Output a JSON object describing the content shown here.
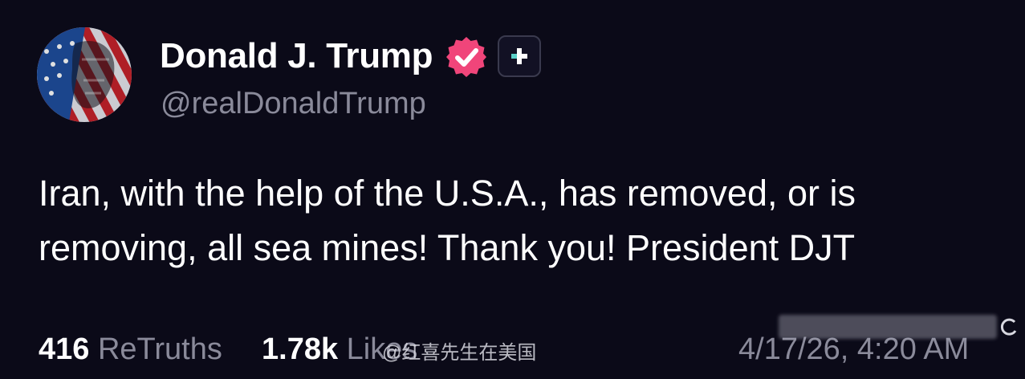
{
  "colors": {
    "background": "#0b0a18",
    "primary_text": "#ffffff",
    "secondary_text": "#8a8a9a",
    "verified_badge": "#f0457a"
  },
  "author": {
    "display_name": "Donald J. Trump",
    "handle": "@realDonaldTrump",
    "avatar_icon": "avatar-american-flag-portrait",
    "verified_icon": "verified-badge-icon",
    "extra_badge_icon": "plus-badge-icon"
  },
  "post": {
    "text": "Iran, with the help of the U.S.A., has removed, or is removing, all sea mines! Thank you! President DJT"
  },
  "footer": {
    "retruths_count": "416",
    "retruths_label": "ReTruths",
    "likes_count": "1.78k",
    "likes_label": "Likes",
    "timestamp": "4/17/26, 4:20 AM"
  },
  "watermark": {
    "text": "@红喜先生在美国"
  }
}
